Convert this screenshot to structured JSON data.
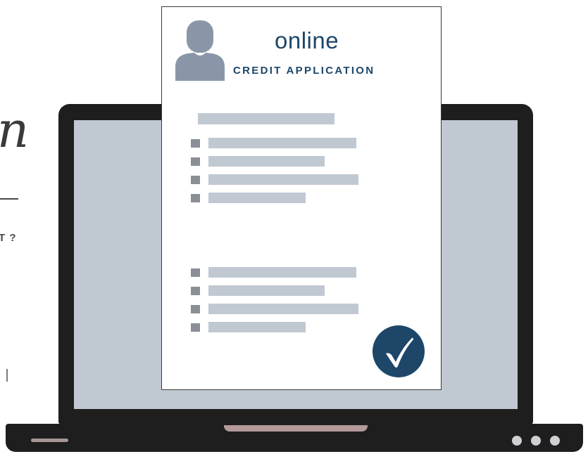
{
  "left_fragments": {
    "script_letter": "n",
    "question_fragment": "T ?"
  },
  "document": {
    "title": "online",
    "subtitle": "CREDIT APPLICATION",
    "check_mark": "✓",
    "heading_placeholder_count": 1,
    "list_groups": [
      {
        "items": 4
      },
      {
        "items": 4
      }
    ]
  },
  "laptop": {
    "indicator_lights": 3
  },
  "colors": {
    "brand_navy": "#1d4669",
    "placeholder_gray": "#c0c8d1",
    "bullet_gray": "#8a8f96",
    "laptop_body": "#1e1e1e",
    "accent_mauve": "#b49a9a",
    "avatar_gray": "#8a96a8"
  },
  "icons": [
    "user-avatar-icon",
    "checkmark-badge-icon"
  ]
}
